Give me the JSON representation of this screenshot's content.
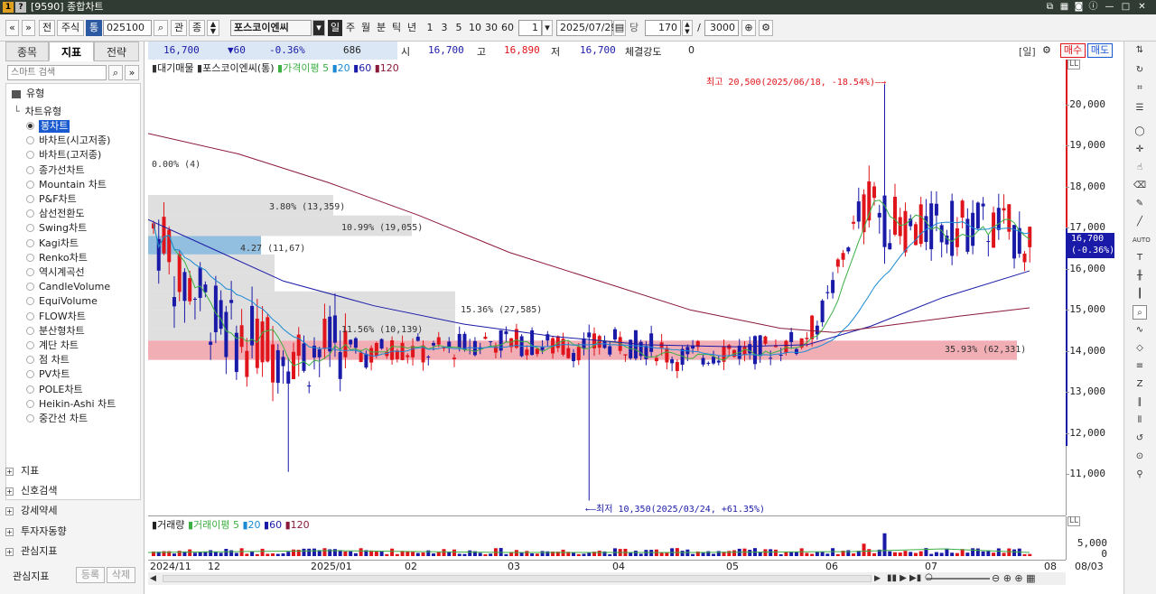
{
  "titlebar": {
    "title": "[9590] 종합차트"
  },
  "toolbar": {
    "buttons": [
      "전",
      "주식",
      "통"
    ],
    "code": "025100",
    "btn_gwan": "관",
    "btn_jong": "종",
    "stock_name": "포스코이엔씨",
    "btn_i": "i",
    "periods": [
      "일",
      "주",
      "월",
      "분",
      "틱",
      "년"
    ],
    "counts": [
      "1",
      "3",
      "5",
      "10",
      "30",
      "60"
    ],
    "unit_value": "1",
    "date": "2025/07/29",
    "dang": "당",
    "count_value": "170",
    "slash": "/",
    "total_value": "3000"
  },
  "left_panel": {
    "tabs": [
      "종목",
      "지표",
      "전략"
    ],
    "search_placeholder": "스마트 검색",
    "tree_root": "유형",
    "tree_group": "차트유형",
    "chart_types": [
      "봉차트",
      "바차트(시고저종)",
      "바차트(고저종)",
      "종가선차트",
      "Mountain 차트",
      "P&F차트",
      "삼선전환도",
      "Swing차트",
      "Kagi차트",
      "Renko차트",
      "역시계곡선",
      "CandleVolume",
      "EquiVolume",
      "FLOW차트",
      "분산형차트",
      "계단 차트",
      "점 차트",
      "PV차트",
      "POLE차트",
      "Heikin-Ashi 차트",
      "중간선 차트"
    ],
    "selected_index": 0,
    "sections": [
      "지표",
      "신호검색",
      "강세약세",
      "투자자동향",
      "관심지표"
    ],
    "bottom_label": "관심지표",
    "btn_add": "등록",
    "btn_del": "삭제"
  },
  "infobar": {
    "price": "16,700",
    "change": "▼60",
    "change_pct": "-0.36%",
    "volume": "686",
    "open_label": "시",
    "open": "16,700",
    "high_label": "고",
    "high": "16,890",
    "low_label": "저",
    "low": "16,700",
    "strength_label": "체결강도",
    "strength": "0",
    "btn_day": "[일]",
    "btn_buy": "매수",
    "btn_sell": "매도"
  },
  "chart_header": {
    "title": "대기매물",
    "stock": "포스코이엔씨(통)",
    "ma_label": "가격이평",
    "ma": [
      "5",
      "20",
      "60",
      "120"
    ]
  },
  "volume_header": {
    "title": "거래량",
    "ma_label": "거래이평",
    "ma": [
      "5",
      "20",
      "60",
      "120"
    ]
  },
  "annotations": {
    "high": "최고 20,500(2025/06/18, -18.54%)",
    "low": "최저 10,350(2025/03/24, +61.35%)",
    "current": "16,700",
    "current_pct": "(-0.36%)",
    "profile": [
      "0.00% (4)",
      "3.80% (13,359)",
      "10.99% (19,055)",
      "4.27 (11,67)",
      "15.36% (27,585)",
      "11.56% (10,139)",
      "35.93% (62,331)"
    ]
  },
  "colors": {
    "up": "#e0141b",
    "down": "#1a1aa8",
    "ma5": "#3cb043",
    "ma20": "#1a8ad4",
    "ma60": "#1a1aa8",
    "ma120": "#8b1a3a",
    "profile_hi": "#f0a0a8",
    "profile": "#d9d9d9"
  },
  "chart_data": {
    "type": "candlestick",
    "title": "대기매물",
    "xlabel": "",
    "ylabel": "",
    "ylim": [
      10350,
      20500
    ],
    "y_ticks": [
      "20,000",
      "19,000",
      "18,000",
      "17,000",
      "16,000",
      "15,000",
      "14,000",
      "13,000",
      "12,000",
      "11,000"
    ],
    "x_ticks": [
      "2024/11",
      "12",
      "2025/01",
      "02",
      "03",
      "04",
      "05",
      "06",
      "07",
      "08",
      "08/03"
    ],
    "y_min_tick": 11000,
    "y_max_tick": 20000,
    "volume_ticks": [
      "5,000",
      "0"
    ],
    "high": 20500,
    "low": 10350,
    "last": 16700
  }
}
